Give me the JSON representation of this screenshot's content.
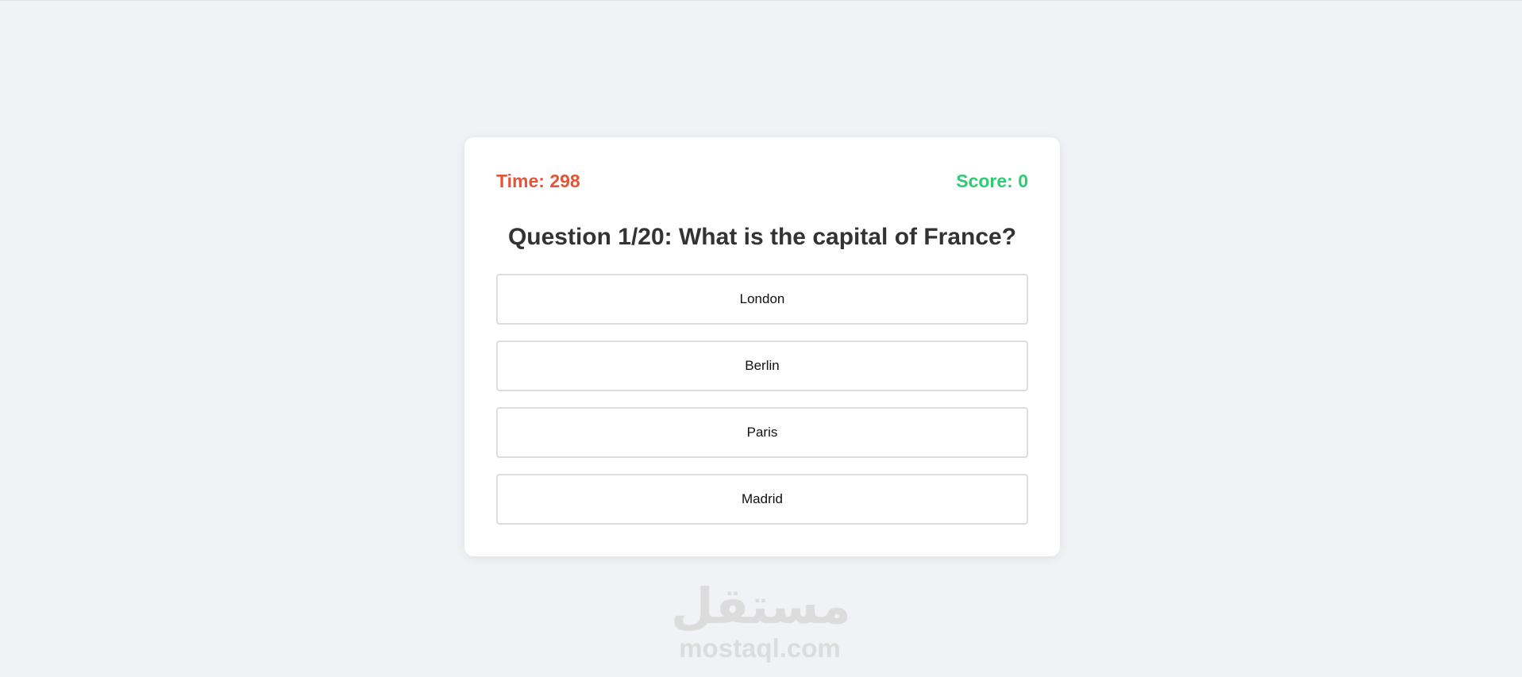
{
  "quiz": {
    "timer_text": "Time: 298",
    "score_text": "Score: 0",
    "question_text": "Question 1/20: What is the capital of France?",
    "options": [
      {
        "label": "London"
      },
      {
        "label": "Berlin"
      },
      {
        "label": "Paris"
      },
      {
        "label": "Madrid"
      }
    ]
  },
  "watermark": {
    "arabic": "مستقل",
    "latin": "mostaql.com"
  },
  "colors": {
    "background": "#f0f2f5",
    "timer": "#e2553a",
    "score": "#2ecc71",
    "question": "#333333",
    "option_border": "#dddddd"
  }
}
